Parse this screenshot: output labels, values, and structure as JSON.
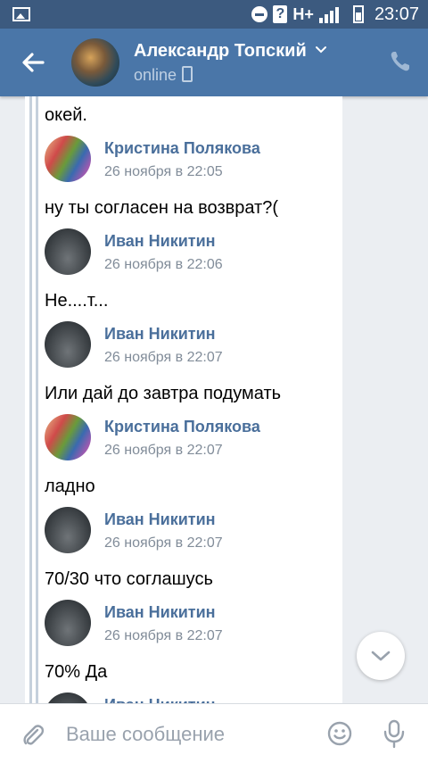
{
  "status_bar": {
    "network": "H+",
    "time": "23:07"
  },
  "header": {
    "title": "Александр Топский",
    "status": "online"
  },
  "messages": {
    "top_text": "окей.",
    "items": [
      {
        "author": "Кристина Полякова",
        "date": "26 ноября в 22:05",
        "text": "ну ты согласен на возврат?("
      },
      {
        "author": "Иван Никитин",
        "date": "26 ноября в 22:06",
        "text": "Не....т..."
      },
      {
        "author": "Иван Никитин",
        "date": "26 ноября в 22:07",
        "text": "Или дай до завтра подумать"
      },
      {
        "author": "Кристина Полякова",
        "date": "26 ноября в 22:07",
        "text": "ладно"
      },
      {
        "author": "Иван Никитин",
        "date": "26 ноября в 22:07",
        "text": "70/30 что соглашусь"
      },
      {
        "author": "Иван Никитин",
        "date": "26 ноября в 22:07",
        "text": "70% Да"
      },
      {
        "author": "Иван Никитин",
        "date": "",
        "text": ""
      }
    ]
  },
  "composer": {
    "placeholder": "Ваше сообщение"
  },
  "icons": {
    "back": "arrow-left-icon",
    "chevron": "chevron-down-icon",
    "phone": "phone-icon",
    "scroll_down": "chevron-down-icon",
    "attach": "paperclip-icon",
    "emoji": "smiley-icon",
    "mic": "microphone-icon"
  },
  "colors": {
    "header": "#4a76a8",
    "status_bar": "#3c5a7f",
    "author_name": "#4a6f9b",
    "background": "#ebeef2"
  }
}
